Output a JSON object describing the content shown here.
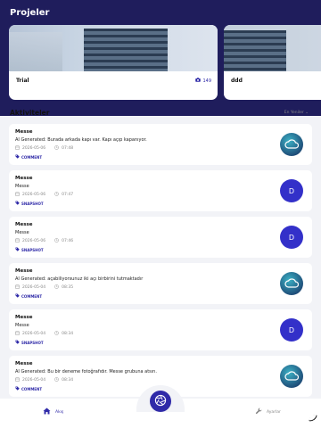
{
  "header": {
    "title": "Projeler"
  },
  "projects": [
    {
      "name": "Trial",
      "photo_count": "149",
      "icon": "camera-icon"
    },
    {
      "name": "ddd"
    }
  ],
  "activities_section": {
    "title": "Aktiviteler",
    "sort_label": "En Yeniler"
  },
  "activities": [
    {
      "title": "Messe",
      "description": "AI Generated: Burada arkada kapı var. Kapı açıp kapanıyor.",
      "date": "2026-05-06",
      "time": "07:48",
      "tag": "COMMENT",
      "avatar": "cloud"
    },
    {
      "title": "Messe",
      "description": "Messe",
      "date": "2026-05-06",
      "time": "07:47",
      "tag": "SNAPSHOT",
      "avatar": "D"
    },
    {
      "title": "Messe",
      "description": "Messe",
      "date": "2026-05-06",
      "time": "07:46",
      "tag": "SNAPSHOT",
      "avatar": "D"
    },
    {
      "title": "Messe",
      "description": "AI Generated: açabiliyorsunuz iki açı birbirini tutmaktadır",
      "date": "2026-05-04",
      "time": "08:35",
      "tag": "COMMENT",
      "avatar": "cloud"
    },
    {
      "title": "Messe",
      "description": "Messe",
      "date": "2026-05-04",
      "time": "08:34",
      "tag": "SNAPSHOT",
      "avatar": "D"
    },
    {
      "title": "Messe",
      "description": "AI Generated: Bu bir deneme fotoğrafıdır. Messe grubuna atsın.",
      "date": "2026-05-04",
      "time": "08:34",
      "tag": "COMMENT",
      "avatar": "cloud"
    }
  ],
  "bottom_nav": {
    "home_label": "Akış",
    "settings_label": "Ayarlar"
  },
  "colors": {
    "header": "#1f1d5c",
    "accent": "#2f2aa8",
    "avatar_letter": "#3330c9"
  }
}
